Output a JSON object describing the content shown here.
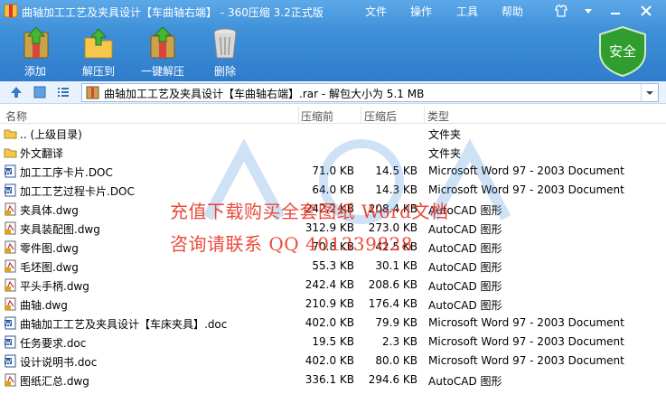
{
  "window": {
    "title": "曲轴加工工艺及夹具设计【车曲轴右端】 - 360压缩 3.2正式版",
    "menus": [
      "文件",
      "操作",
      "工具",
      "帮助"
    ]
  },
  "toolbar": {
    "add": "添加",
    "extract_to": "解压到",
    "one_click": "一键解压",
    "delete": "删除",
    "safety_badge": "安全"
  },
  "address": {
    "path": "曲轴加工工艺及夹具设计【车曲轴右端】.rar - 解包大小为 5.1 MB"
  },
  "columns": {
    "name": "名称",
    "packed": "压缩前",
    "compressed": "压缩后",
    "type": "类型"
  },
  "files": [
    {
      "name": ".. (上级目录)",
      "before": "",
      "after": "",
      "type": "文件夹",
      "icon": "folder"
    },
    {
      "name": "外文翻译",
      "before": "",
      "after": "",
      "type": "文件夹",
      "icon": "folder"
    },
    {
      "name": "加工工序卡片.DOC",
      "before": "71.0 KB",
      "after": "14.5 KB",
      "type": "Microsoft Word 97 - 2003 Document",
      "icon": "word"
    },
    {
      "name": "加工工艺过程卡片.DOC",
      "before": "64.0 KB",
      "after": "14.3 KB",
      "type": "Microsoft Word 97 - 2003 Document",
      "icon": "word"
    },
    {
      "name": "夹具体.dwg",
      "before": "242.2 KB",
      "after": "208.4 KB",
      "type": "AutoCAD 图形",
      "icon": "dwg"
    },
    {
      "name": "夹具装配图.dwg",
      "before": "312.9 KB",
      "after": "273.0 KB",
      "type": "AutoCAD 图形",
      "icon": "dwg"
    },
    {
      "name": "零件图.dwg",
      "before": "70.8 KB",
      "after": "42.5 KB",
      "type": "AutoCAD 图形",
      "icon": "dwg"
    },
    {
      "name": "毛坯图.dwg",
      "before": "55.3 KB",
      "after": "30.1 KB",
      "type": "AutoCAD 图形",
      "icon": "dwg"
    },
    {
      "name": "平头手柄.dwg",
      "before": "242.4 KB",
      "after": "208.6 KB",
      "type": "AutoCAD 图形",
      "icon": "dwg"
    },
    {
      "name": "曲轴.dwg",
      "before": "210.9 KB",
      "after": "176.4 KB",
      "type": "AutoCAD 图形",
      "icon": "dwg"
    },
    {
      "name": "曲轴加工工艺及夹具设计【车床夹具】.doc",
      "before": "402.0 KB",
      "after": "79.9 KB",
      "type": "Microsoft Word 97 - 2003 Document",
      "icon": "word"
    },
    {
      "name": "任务要求.doc",
      "before": "19.5 KB",
      "after": "2.3 KB",
      "type": "Microsoft Word 97 - 2003 Document",
      "icon": "word"
    },
    {
      "name": "设计说明书.doc",
      "before": "402.0 KB",
      "after": "80.0 KB",
      "type": "Microsoft Word 97 - 2003 Document",
      "icon": "word"
    },
    {
      "name": "图纸汇总.dwg",
      "before": "336.1 KB",
      "after": "294.6 KB",
      "type": "AutoCAD 图形",
      "icon": "dwg"
    }
  ],
  "watermark": {
    "line1": "充值下载购买全套图纸 Word文档",
    "line2": "咨询请联系  QQ 401339828"
  }
}
